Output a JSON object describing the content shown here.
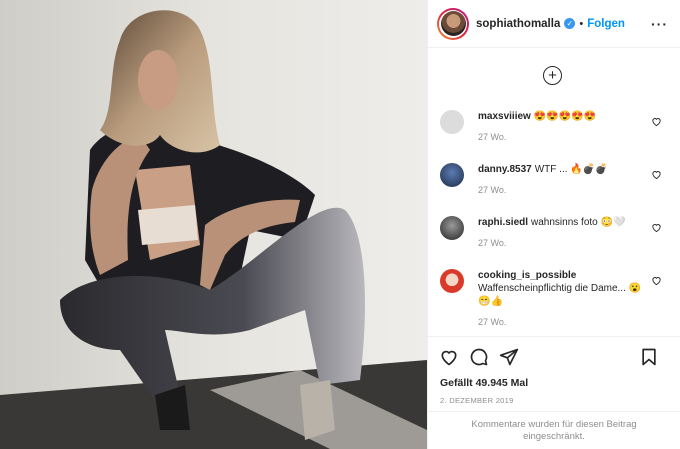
{
  "post": {
    "username": "sophiathomalla",
    "verified_icon": "verified-badge-icon",
    "follow_label": "Folgen",
    "more_label": "···",
    "load_more_label": "+",
    "likes": "Gefällt 49.945 Mal",
    "date": "2. DEZEMBER 2019",
    "comments_limited": "Kommentare wurden für diesen Beitrag eingeschränkt."
  },
  "comments": [
    {
      "user": "maxsviiiew",
      "text": "😍😍😍😍😍",
      "time": "27 Wo.",
      "avatar_color": "#d8d8d8"
    },
    {
      "user": "danny.8537",
      "text": "WTF ... 🔥💣💣",
      "time": "27 Wo.",
      "avatar_color": "#2c3e63"
    },
    {
      "user": "raphi.siedl",
      "text": "wahnsinns foto 😳🤍",
      "time": "27 Wo.",
      "avatar_color": "#3b3b3b"
    },
    {
      "user": "cooking_is_possible",
      "text": "Waffenscheinpflichtig die Dame... 😮😁👍",
      "time": "27 Wo.",
      "avatar_color": "#c0392b"
    }
  ],
  "icons": {
    "like": "heart-icon",
    "comment": "comment-icon",
    "share": "paper-plane-icon",
    "save": "bookmark-icon"
  }
}
